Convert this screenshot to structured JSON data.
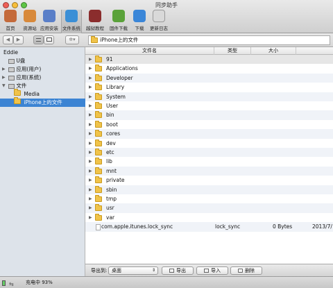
{
  "window": {
    "title": "同步助手"
  },
  "toolbar": {
    "buttons": [
      {
        "label": "首页",
        "icon": "home-icon",
        "color": "#c46a3a"
      },
      {
        "label": "资源站",
        "icon": "shop-icon",
        "color": "#d8893a"
      },
      {
        "label": "应用安装",
        "icon": "apps-icon",
        "color": "#5a7fc8"
      },
      {
        "label": "文件系统",
        "icon": "filesystem-icon",
        "color": "#3b8fd6"
      },
      {
        "label": "越狱教程",
        "icon": "book-icon",
        "color": "#8b2d2d"
      },
      {
        "label": "固件下载",
        "icon": "firmware-icon",
        "color": "#5aa23a"
      },
      {
        "label": "下载",
        "icon": "download-icon",
        "color": "#3a86d8"
      },
      {
        "label": "更新日志",
        "icon": "calendar-icon",
        "color": "#d9d9d9"
      }
    ],
    "active_index": 3
  },
  "navbar": {
    "back_icon": "◀",
    "forward_icon": "▶",
    "view_list_icon": "list-view-icon",
    "view_column_icon": "column-view-icon",
    "action_icon": "✲▾",
    "path": "iPhone上的文件"
  },
  "sidebar": {
    "device": "Eddie",
    "items": [
      {
        "label": "U盘"
      },
      {
        "label": "应用(用户)"
      },
      {
        "label": "应用(系统)"
      },
      {
        "label": "文件"
      },
      {
        "label": "Media"
      },
      {
        "label": "iPhone上的文件"
      }
    ]
  },
  "columns": {
    "name": "文件名",
    "type": "类型",
    "size": "大小"
  },
  "files": [
    {
      "name": "91"
    },
    {
      "name": "Applications"
    },
    {
      "name": "Developer"
    },
    {
      "name": "Library"
    },
    {
      "name": "System"
    },
    {
      "name": "User"
    },
    {
      "name": "bin"
    },
    {
      "name": "boot"
    },
    {
      "name": "cores"
    },
    {
      "name": "dev"
    },
    {
      "name": "etc"
    },
    {
      "name": "lib"
    },
    {
      "name": "mnt"
    },
    {
      "name": "private"
    },
    {
      "name": "sbin"
    },
    {
      "name": "tmp"
    },
    {
      "name": "usr"
    },
    {
      "name": "var"
    },
    {
      "name": "com.apple.itunes.lock_sync",
      "type": "lock_sync",
      "size": "0 Bytes",
      "date": "2013/7/"
    }
  ],
  "bottombar": {
    "export_label": "导出到:",
    "export_target": "桌面",
    "export_button": "导出",
    "import_button": "导入",
    "delete_button": "删除"
  },
  "status": {
    "text": "充电中 93%",
    "battery_fraction": 0.93
  }
}
